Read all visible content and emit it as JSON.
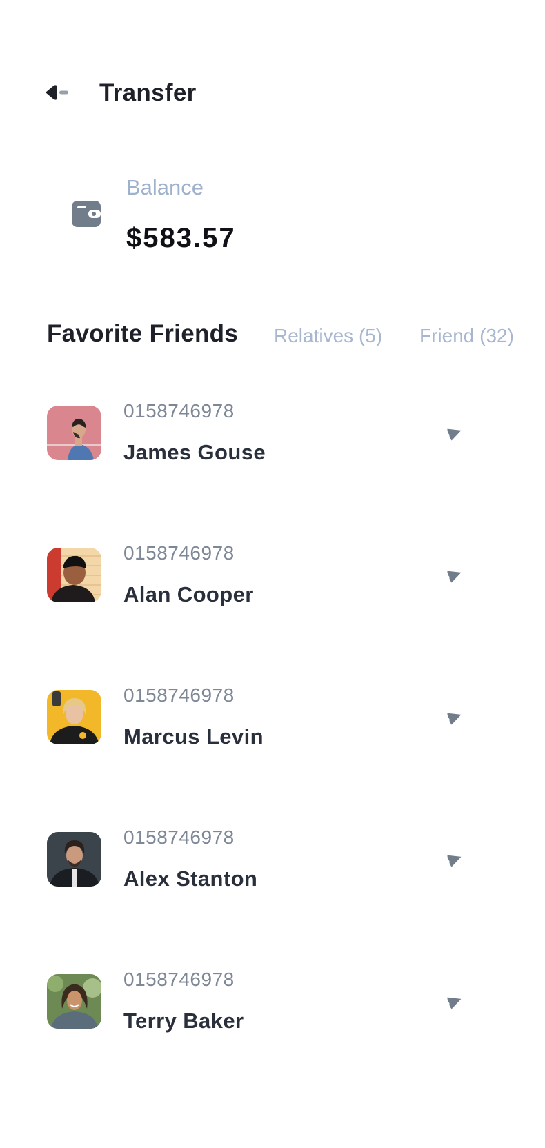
{
  "header": {
    "title": "Transfer",
    "back_icon": "arrow-left-icon"
  },
  "balance": {
    "label": "Balance",
    "amount": "$583.57",
    "icon": "wallet-icon"
  },
  "tabs": [
    {
      "label": "Favorite Friends",
      "active": true
    },
    {
      "label": "Relatives (5)",
      "active": false
    },
    {
      "label": "Friend (32)",
      "active": false
    }
  ],
  "friends": [
    {
      "phone": "0158746978",
      "name": "James Gouse"
    },
    {
      "phone": "0158746978",
      "name": "Alan Cooper"
    },
    {
      "phone": "0158746978",
      "name": "Marcus Levin"
    },
    {
      "phone": "0158746978",
      "name": "Alex Stanton"
    },
    {
      "phone": "0158746978",
      "name": "Terry Baker"
    }
  ],
  "colors": {
    "primary_text": "#1e2129",
    "muted_label": "#9fb2cc",
    "tab_inactive": "#a6b7cf",
    "phone_text": "#7d8796",
    "icon_gray": "#727d8c"
  }
}
